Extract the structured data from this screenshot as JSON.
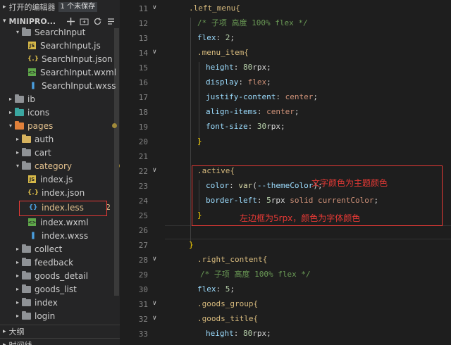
{
  "sidebar": {
    "open_editors_label": "打开的编辑器",
    "unsaved_badge": "1 个未保存",
    "project_name": "MINIPRO...",
    "tree": [
      {
        "label": "SearchInput",
        "kind": "folder",
        "expanded": true,
        "depth": 1
      },
      {
        "label": "SearchInput.js",
        "kind": "js",
        "depth": 2
      },
      {
        "label": "SearchInput.json",
        "kind": "json",
        "depth": 2
      },
      {
        "label": "SearchInput.wxml",
        "kind": "wxml",
        "depth": 2
      },
      {
        "label": "SearchInput.wxss",
        "kind": "wxss",
        "depth": 2
      },
      {
        "label": "ib",
        "kind": "folder",
        "depth": 0
      },
      {
        "label": "icons",
        "kind": "folder",
        "depth": 0
      },
      {
        "label": "pages",
        "kind": "folder",
        "expanded": true,
        "depth": 0,
        "modified": true
      },
      {
        "label": "auth",
        "kind": "folder",
        "depth": 1
      },
      {
        "label": "cart",
        "kind": "folder",
        "depth": 1
      },
      {
        "label": "category",
        "kind": "folder",
        "expanded": true,
        "depth": 1,
        "modified": true
      },
      {
        "label": "index.js",
        "kind": "js",
        "depth": 2
      },
      {
        "label": "index.json",
        "kind": "json",
        "depth": 2
      },
      {
        "label": "index.less",
        "kind": "less",
        "depth": 2,
        "selected": true,
        "badge": "2"
      },
      {
        "label": "index.wxml",
        "kind": "wxml",
        "depth": 2
      },
      {
        "label": "index.wxss",
        "kind": "wxss",
        "depth": 2
      },
      {
        "label": "collect",
        "kind": "folder",
        "depth": 1
      },
      {
        "label": "feedback",
        "kind": "folder",
        "depth": 1
      },
      {
        "label": "goods_detail",
        "kind": "folder",
        "depth": 1
      },
      {
        "label": "goods_list",
        "kind": "folder",
        "depth": 1
      },
      {
        "label": "index",
        "kind": "folder",
        "depth": 1
      },
      {
        "label": "login",
        "kind": "folder",
        "depth": 1
      }
    ],
    "outline_label": "大纲",
    "timeline_label": "时间线"
  },
  "editor": {
    "line_numbers": [
      "11",
      "12",
      "13",
      "14",
      "15",
      "16",
      "17",
      "18",
      "19",
      "20",
      "21",
      "22",
      "23",
      "24",
      "25",
      "26",
      "27",
      "28",
      "29",
      "30",
      "31",
      "32",
      "33"
    ],
    "lines": {
      "l11": ".left_menu{",
      "l12": "/* 子项 高度 100% flex */",
      "l13a": "flex",
      "l13b": "2",
      "l14": ".menu_item{",
      "l15a": "height",
      "l15b": "80",
      "l15c": "rpx",
      "l16a": "display",
      "l16b": "flex",
      "l17a": "justify-content",
      "l17b": "center",
      "l18a": "align-items",
      "l18b": "center",
      "l19a": "font-size",
      "l19b": "30",
      "l19c": "rpx",
      "l20": "}",
      "l22": ".active{",
      "l23a": "color",
      "l23b": "var",
      "l23c": "--themeColor",
      "l24a": "border-left",
      "l24b": "5",
      "l24c": "rpx",
      "l24d": "solid",
      "l24e": "currentColor",
      "l25": "}",
      "l27": "}",
      "l28": ".right_content{",
      "l29": "/* 子项 高度 100% flex */",
      "l30a": "flex",
      "l30b": "5",
      "l31": ".goods_group{",
      "l32": ".goods_title{",
      "l33a": "height",
      "l33b": "80",
      "l33c": "rpx"
    },
    "annotations": {
      "color_note": "文字颜色为主题颜色",
      "border_note": "左边框为5rpx，颜色为字体颜色"
    }
  }
}
